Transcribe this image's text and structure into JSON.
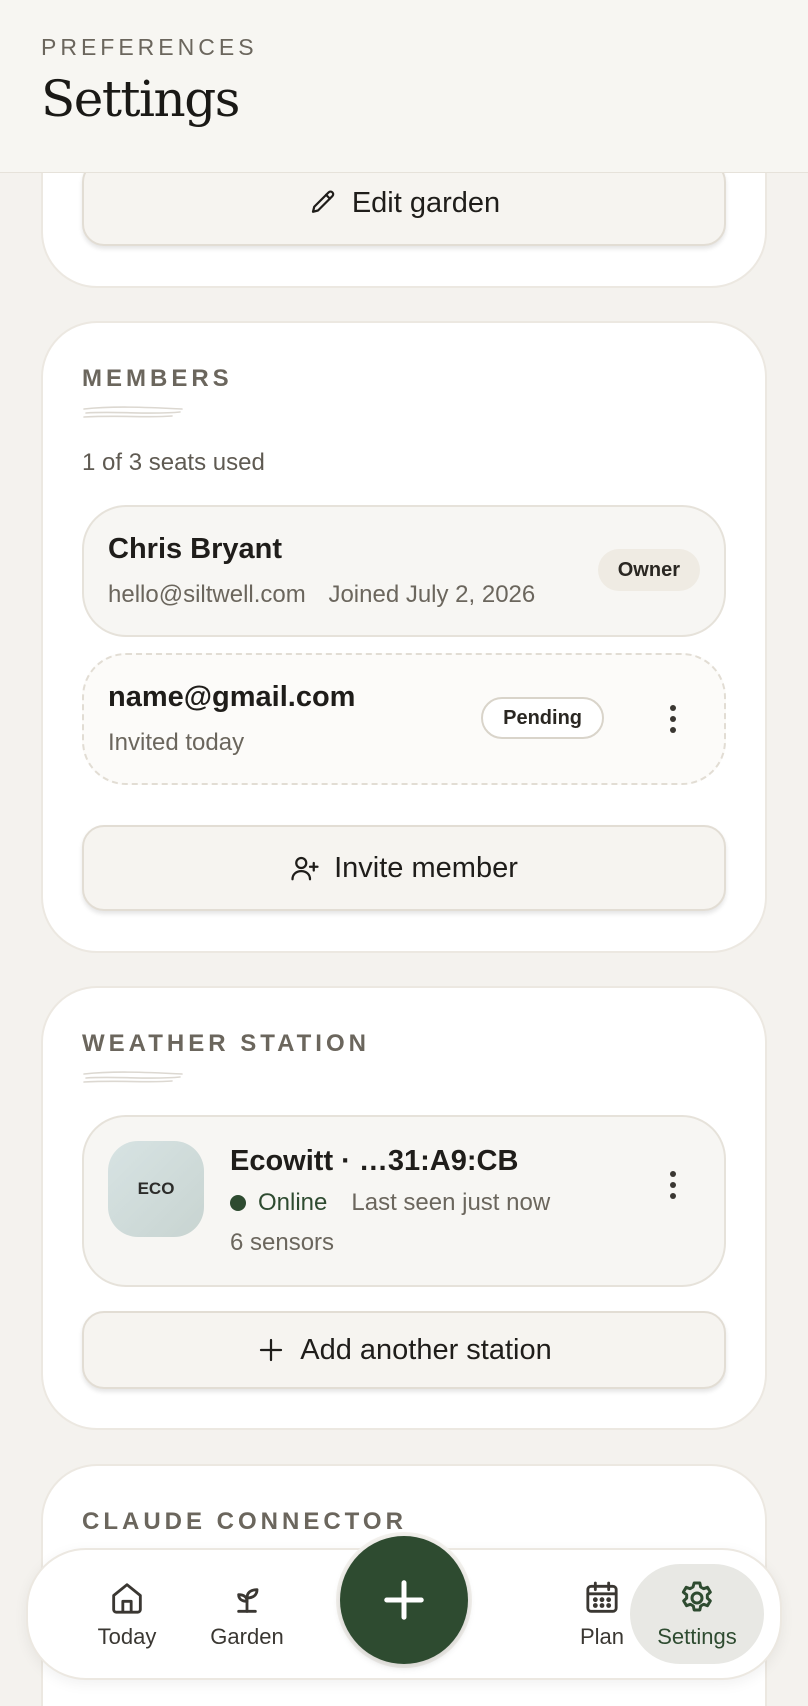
{
  "header": {
    "eyebrow": "PREFERENCES",
    "title": "Settings"
  },
  "garden_card": {
    "edit_label": "Edit garden"
  },
  "members": {
    "label": "MEMBERS",
    "seats": "1 of 3 seats used",
    "owner": {
      "name": "Chris Bryant",
      "email": "hello@siltwell.com",
      "joined": "Joined July 2, 2026",
      "badge": "Owner"
    },
    "pending": {
      "name": "name@gmail.com",
      "invited": "Invited today",
      "badge": "Pending"
    },
    "invite_label": "Invite member"
  },
  "weather": {
    "label": "WEATHER STATION",
    "station": {
      "logo_text": "ECO",
      "name": "Ecowitt · …31:A9:CB",
      "status": "Online",
      "last_seen": "Last seen just now",
      "sensors": "6 sensors"
    },
    "add_label": "Add another station"
  },
  "claude": {
    "label": "CLAUDE CONNECTOR"
  },
  "nav": {
    "today": "Today",
    "garden": "Garden",
    "plan": "Plan",
    "settings": "Settings"
  },
  "colors": {
    "accent": "#2e4b30",
    "background": "#f4f2ee",
    "card": "#ffffff"
  },
  "icons": {
    "edit": "pencil-icon",
    "invite": "user-plus-icon",
    "add": "plus-icon",
    "more": "kebab-icon",
    "today": "home-icon",
    "garden": "sprout-icon",
    "plan": "calendar-icon",
    "settings": "gear-icon"
  }
}
